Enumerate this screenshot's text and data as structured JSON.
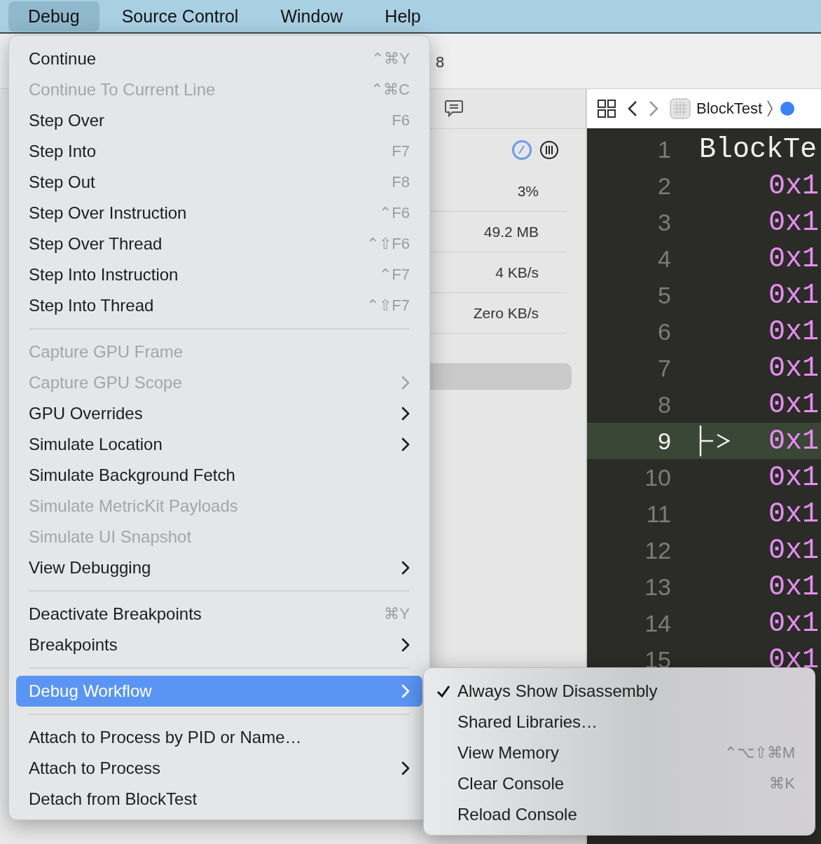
{
  "menubar": [
    {
      "label": "Debug",
      "selected": true
    },
    {
      "label": "Source Control",
      "selected": false
    },
    {
      "label": "Window",
      "selected": false
    },
    {
      "label": "Help",
      "selected": false
    }
  ],
  "toolbar": {
    "title_fragment": "8"
  },
  "gauges": {
    "values": [
      "3%",
      "49.2 MB",
      "4 KB/s",
      "Zero KB/s"
    ]
  },
  "editor": {
    "breadcrumb": "BlockTest",
    "lines": [
      {
        "number": "1",
        "code": "BlockTe",
        "kind": "title",
        "current": false
      },
      {
        "number": "2",
        "code": "0x1",
        "kind": "address",
        "current": false
      },
      {
        "number": "3",
        "code": "0x1",
        "kind": "address",
        "current": false
      },
      {
        "number": "4",
        "code": "0x1",
        "kind": "address",
        "current": false
      },
      {
        "number": "5",
        "code": "0x1",
        "kind": "address",
        "current": false
      },
      {
        "number": "6",
        "code": "0x1",
        "kind": "address",
        "current": false
      },
      {
        "number": "7",
        "code": "0x1",
        "kind": "address",
        "current": false
      },
      {
        "number": "8",
        "code": "0x1",
        "kind": "address",
        "current": false
      },
      {
        "number": "9",
        "code": "0x1",
        "kind": "address",
        "current": true
      },
      {
        "number": "10",
        "code": "0x1",
        "kind": "address",
        "current": false
      },
      {
        "number": "11",
        "code": "0x1",
        "kind": "address",
        "current": false
      },
      {
        "number": "12",
        "code": "0x1",
        "kind": "address",
        "current": false
      },
      {
        "number": "13",
        "code": "0x1",
        "kind": "address",
        "current": false
      },
      {
        "number": "14",
        "code": "0x1",
        "kind": "address",
        "current": false
      },
      {
        "number": "15",
        "code": "0x1",
        "kind": "address",
        "current": false
      }
    ]
  },
  "menu": {
    "items": [
      {
        "kind": "item",
        "label": "Continue",
        "shortcut": "⌃⌘Y",
        "disabled": false,
        "submenu": false,
        "selected": false
      },
      {
        "kind": "item",
        "label": "Continue To Current Line",
        "shortcut": "⌃⌘C",
        "disabled": true,
        "submenu": false,
        "selected": false
      },
      {
        "kind": "item",
        "label": "Step Over",
        "shortcut": "F6",
        "disabled": false,
        "submenu": false,
        "selected": false
      },
      {
        "kind": "item",
        "label": "Step Into",
        "shortcut": "F7",
        "disabled": false,
        "submenu": false,
        "selected": false
      },
      {
        "kind": "item",
        "label": "Step Out",
        "shortcut": "F8",
        "disabled": false,
        "submenu": false,
        "selected": false
      },
      {
        "kind": "item",
        "label": "Step Over Instruction",
        "shortcut": "⌃F6",
        "disabled": false,
        "submenu": false,
        "selected": false
      },
      {
        "kind": "item",
        "label": "Step Over Thread",
        "shortcut": "⌃⇧F6",
        "disabled": false,
        "submenu": false,
        "selected": false
      },
      {
        "kind": "item",
        "label": "Step Into Instruction",
        "shortcut": "⌃F7",
        "disabled": false,
        "submenu": false,
        "selected": false
      },
      {
        "kind": "item",
        "label": "Step Into Thread",
        "shortcut": "⌃⇧F7",
        "disabled": false,
        "submenu": false,
        "selected": false
      },
      {
        "kind": "separator"
      },
      {
        "kind": "item",
        "label": "Capture GPU Frame",
        "disabled": true,
        "submenu": false,
        "selected": false
      },
      {
        "kind": "item",
        "label": "Capture GPU Scope",
        "disabled": true,
        "submenu": true,
        "selected": false
      },
      {
        "kind": "item",
        "label": "GPU Overrides",
        "disabled": false,
        "submenu": true,
        "selected": false
      },
      {
        "kind": "item",
        "label": "Simulate Location",
        "disabled": false,
        "submenu": true,
        "selected": false
      },
      {
        "kind": "item",
        "label": "Simulate Background Fetch",
        "disabled": false,
        "submenu": false,
        "selected": false
      },
      {
        "kind": "item",
        "label": "Simulate MetricKit Payloads",
        "disabled": true,
        "submenu": false,
        "selected": false
      },
      {
        "kind": "item",
        "label": "Simulate UI Snapshot",
        "disabled": true,
        "submenu": false,
        "selected": false
      },
      {
        "kind": "item",
        "label": "View Debugging",
        "disabled": false,
        "submenu": true,
        "selected": false
      },
      {
        "kind": "separator"
      },
      {
        "kind": "item",
        "label": "Deactivate Breakpoints",
        "shortcut": "⌘Y",
        "disabled": false,
        "submenu": false,
        "selected": false
      },
      {
        "kind": "item",
        "label": "Breakpoints",
        "disabled": false,
        "submenu": true,
        "selected": false
      },
      {
        "kind": "separator"
      },
      {
        "kind": "item",
        "label": "Debug Workflow",
        "disabled": false,
        "submenu": true,
        "selected": true
      },
      {
        "kind": "separator"
      },
      {
        "kind": "item",
        "label": "Attach to Process by PID or Name…",
        "disabled": false,
        "submenu": false,
        "selected": false
      },
      {
        "kind": "item",
        "label": "Attach to Process",
        "disabled": false,
        "submenu": true,
        "selected": false
      },
      {
        "kind": "item",
        "label": "Detach from BlockTest",
        "disabled": false,
        "submenu": false,
        "selected": false
      }
    ]
  },
  "submenu": {
    "items": [
      {
        "label": "Always Show Disassembly",
        "checked": true
      },
      {
        "label": "Shared Libraries…",
        "checked": false
      },
      {
        "label": "View Memory",
        "shortcut": "⌃⌥⇧⌘M",
        "checked": false
      },
      {
        "label": "Clear Console",
        "shortcut": "⌘K",
        "checked": false
      },
      {
        "label": "Reload Console",
        "checked": false
      }
    ]
  }
}
